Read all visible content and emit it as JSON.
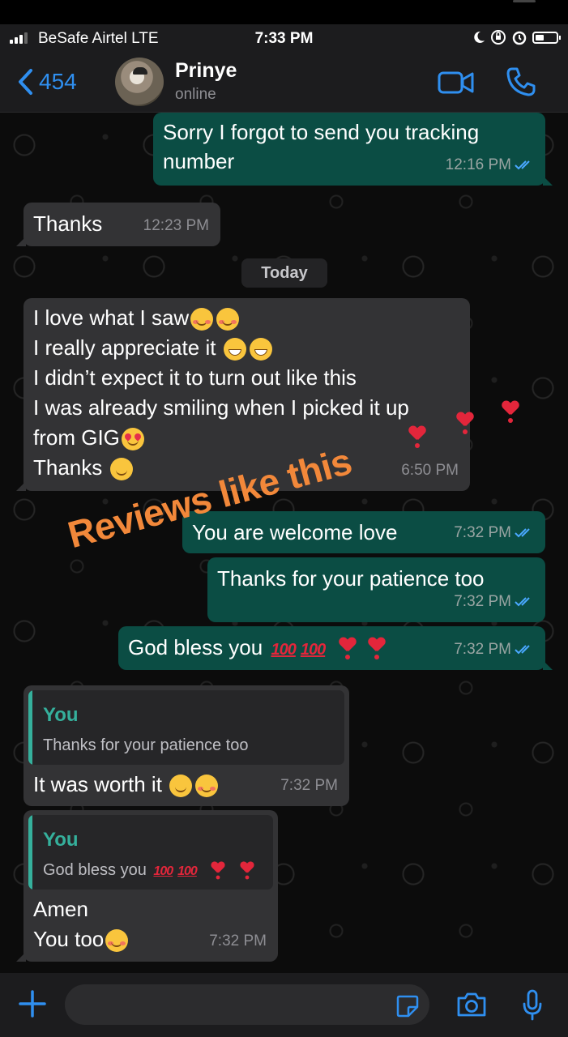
{
  "status": {
    "carrier": "BeSafe Airtel  LTE",
    "time": "7:33 PM"
  },
  "header": {
    "back_count": "454",
    "contact_name": "Prinye",
    "contact_status": "online"
  },
  "date_separator": "Today",
  "messages": [
    {
      "lines": [
        "Sorry I forgot to send you tracking",
        "number"
      ],
      "time": "12:16 PM"
    },
    {
      "text": "Thanks",
      "time": "12:23 PM"
    },
    {
      "lines": [
        "I love what I saw",
        "I really appreciate it",
        "I didn’t expect it to turn out like this",
        "I was already smiling when I picked it up",
        "from GIG",
        "Thanks"
      ],
      "time": "6:50 PM"
    },
    {
      "text": "You are welcome love",
      "time": "7:32 PM"
    },
    {
      "text": "Thanks for your patience too",
      "time": "7:32 PM"
    },
    {
      "text": "God bless you",
      "time": "7:32 PM"
    },
    {
      "quote_author": "You",
      "quote_text": "Thanks for your patience too",
      "text": "It was worth it",
      "time": "7:32 PM"
    },
    {
      "quote_author": "You",
      "quote_text": "God bless you",
      "lines": [
        "Amen",
        "You too"
      ],
      "time": "7:32 PM"
    }
  ],
  "overlay_text": "Reviews like this",
  "emoji": {
    "hundred": "100"
  },
  "icons": [
    "chevron-left-icon",
    "video-call-icon",
    "phone-icon",
    "plus-icon",
    "sticker-icon",
    "camera-icon",
    "microphone-icon",
    "double-check-icon"
  ],
  "colors": {
    "accent": "#2f8ff0",
    "outgoing_bubble": "#0b4d44",
    "incoming_bubble": "#333335",
    "quote_accent": "#35b09c",
    "overlay": "#f2883a"
  }
}
